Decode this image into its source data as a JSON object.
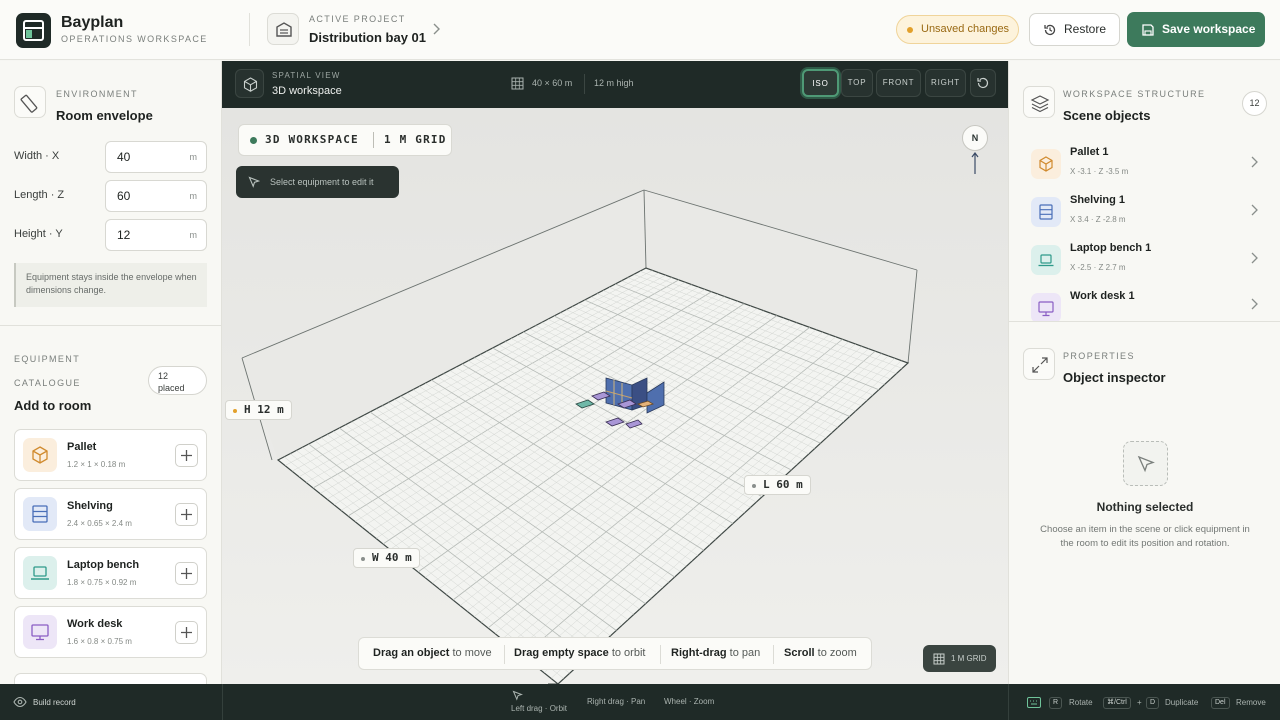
{
  "header": {
    "brand": "Bayplan",
    "brand_sub": "OPERATIONS WORKSPACE",
    "project_label": "ACTIVE PROJECT",
    "project_name": "Distribution bay 01",
    "unsaved": "Unsaved changes",
    "restore": "Restore",
    "save": "Save workspace"
  },
  "environment": {
    "label": "ENVIRONMENT",
    "title": "Room envelope",
    "fields": [
      {
        "label": "Width · X",
        "value": "40",
        "unit": "m"
      },
      {
        "label": "Length · Z",
        "value": "60",
        "unit": "m"
      },
      {
        "label": "Height · Y",
        "value": "12",
        "unit": "m"
      }
    ],
    "note": "Equipment stays inside the envelope when dimensions change."
  },
  "equipment": {
    "label1": "EQUIPMENT",
    "label2": "CATALOGUE",
    "title": "Add to room",
    "placed_count": "12",
    "placed_label": "placed",
    "items": [
      {
        "name": "Pallet",
        "dims": "1.2 × 1 × 0.18 m"
      },
      {
        "name": "Shelving",
        "dims": "2.4 × 0.65 × 2.4 m"
      },
      {
        "name": "Laptop bench",
        "dims": "1.8 × 0.75 × 0.92 m"
      },
      {
        "name": "Work desk",
        "dims": "1.6 × 0.8 × 0.75 m"
      }
    ]
  },
  "viewport": {
    "label": "SPATIAL VIEW",
    "name": "3D workspace",
    "dims": "40 × 60 m",
    "height": "12 m high",
    "views": [
      "ISO",
      "TOP",
      "FRONT",
      "RIGHT"
    ],
    "active_view": "ISO",
    "chip_a": "3D WORKSPACE",
    "chip_b": "1 M GRID",
    "tooltip": "Select equipment to edit it",
    "compass": "N",
    "tag_h": "H 12 m",
    "tag_l": "L 60 m",
    "tag_w": "W 40 m",
    "hints": [
      {
        "b": "Drag an object",
        "t": "to move"
      },
      {
        "b": "Drag empty space",
        "t": "to orbit"
      },
      {
        "b": "Right-drag",
        "t": "to pan"
      },
      {
        "b": "Scroll",
        "t": "to zoom"
      }
    ],
    "grid_badge": "1 M GRID"
  },
  "structure": {
    "label": "WORKSPACE STRUCTURE",
    "title": "Scene objects",
    "count": "12",
    "items": [
      {
        "name": "Pallet 1",
        "coords": "X -3.1 · Z -3.5 m"
      },
      {
        "name": "Shelving 1",
        "coords": "X 3.4 · Z -2.8 m"
      },
      {
        "name": "Laptop bench 1",
        "coords": "X -2.5 · Z 2.7 m"
      },
      {
        "name": "Work desk 1",
        "coords": ""
      }
    ]
  },
  "properties": {
    "label": "PROPERTIES",
    "title": "Object inspector",
    "empty_title": "Nothing selected",
    "empty_desc": "Choose an item in the scene or click equipment in the room to edit its position and rotation."
  },
  "footer": {
    "build": "Build record",
    "orbit": "Left drag · Orbit",
    "pan": "Right drag · Pan",
    "zoom": "Wheel · Zoom",
    "k_r": "R",
    "rotate": "Rotate",
    "k_ctrl": "⌘/Ctrl",
    "plus": "+",
    "k_d": "D",
    "duplicate": "Duplicate",
    "k_del": "Del",
    "remove": "Remove"
  },
  "colors": {
    "accent": "#3d7a5c",
    "dark": "#1f2a27",
    "pallet": "#fbeedd",
    "shelving": "#e2e9f7",
    "laptop": "#dcf0ec",
    "desk": "#ede6f7"
  }
}
